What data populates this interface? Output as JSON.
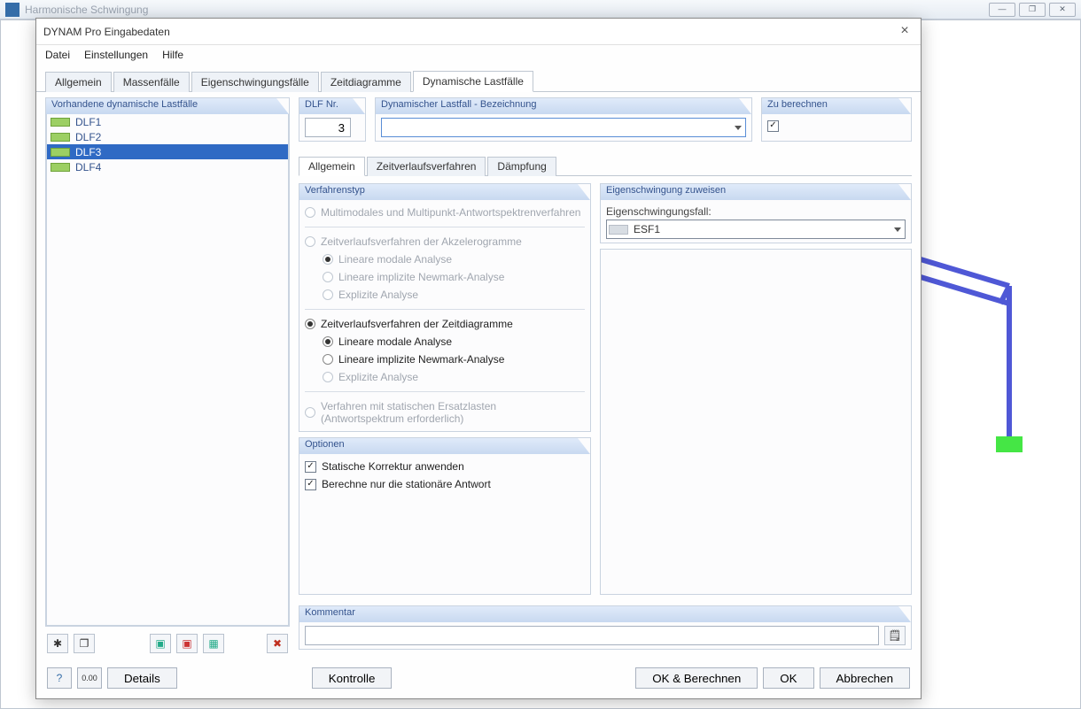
{
  "parentWindow": {
    "title": "Harmonische Schwingung"
  },
  "dialog": {
    "title": "DYNAM Pro Eingabedaten",
    "menu": {
      "file": "Datei",
      "settings": "Einstellungen",
      "help": "Hilfe"
    },
    "mainTabs": {
      "t0": "Allgemein",
      "t1": "Massenfälle",
      "t2": "Eigenschwingungsfälle",
      "t3": "Zeitdiagramme",
      "t4": "Dynamische Lastfälle"
    },
    "leftPane": {
      "header": "Vorhandene dynamische Lastfälle",
      "items": {
        "i0": "DLF1",
        "i1": "DLF2",
        "i2": "DLF3",
        "i3": "DLF4"
      }
    },
    "header": {
      "dlfNrLabel": "DLF Nr.",
      "dlfNrValue": "3",
      "designationLabel": "Dynamischer Lastfall - Bezeichnung",
      "designationValue": "",
      "computeLabel": "Zu berechnen"
    },
    "subTabs": {
      "t0": "Allgemein",
      "t1": "Zeitverlaufsverfahren",
      "t2": "Dämpfung"
    },
    "verfahren": {
      "header": "Verfahrenstyp",
      "r1": "Multimodales und Multipunkt-Antwortspektrenverfahren",
      "r2": "Zeitverlaufsverfahren der Akzelerogramme",
      "r2a": "Lineare modale Analyse",
      "r2b": "Lineare implizite Newmark-Analyse",
      "r2c": "Explizite Analyse",
      "r3": "Zeitverlaufsverfahren der Zeitdiagramme",
      "r3a": "Lineare modale Analyse",
      "r3b": "Lineare implizite Newmark-Analyse",
      "r3c": "Explizite Analyse",
      "r4a": "Verfahren mit statischen Ersatzlasten",
      "r4b": "(Antwortspektrum erforderlich)"
    },
    "optionen": {
      "header": "Optionen",
      "c1": "Statische Korrektur anwenden",
      "c2": "Berechne nur die stationäre Antwort"
    },
    "eigen": {
      "header": "Eigenschwingung zuweisen",
      "label": "Eigenschwingungsfall:",
      "value": "ESF1"
    },
    "kommentar": {
      "header": "Kommentar",
      "value": ""
    },
    "footer": {
      "details": "Details",
      "kontrolle": "Kontrolle",
      "okCalc": "OK & Berechnen",
      "ok": "OK",
      "cancel": "Abbrechen"
    }
  }
}
